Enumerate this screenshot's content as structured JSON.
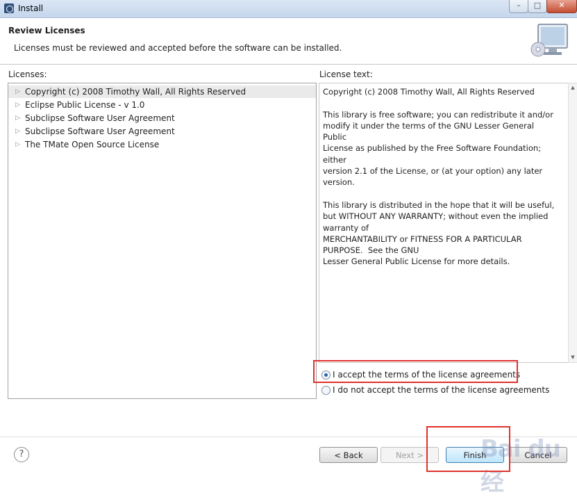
{
  "window": {
    "title": "Install",
    "minimize_glyph": "–",
    "maximize_glyph": "□",
    "close_glyph": "✕"
  },
  "header": {
    "title": "Review Licenses",
    "description": "Licenses must be reviewed and accepted before the software can be installed."
  },
  "licenses": {
    "label": "Licenses:",
    "items": [
      "Copyright (c) 2008 Timothy Wall, All Rights Reserved",
      "Eclipse Public License - v 1.0",
      "Subclipse Software User Agreement",
      "Subclipse Software User Agreement",
      "The TMate Open Source License"
    ],
    "selected_index": 0
  },
  "license_text": {
    "label": "License text:",
    "content": "Copyright (c) 2008 Timothy Wall, All Rights Reserved\n\nThis library is free software; you can redistribute it and/or\nmodify it under the terms of the GNU Lesser General Public\nLicense as published by the Free Software Foundation; either\nversion 2.1 of the License, or (at your option) any later\nversion.\n\nThis library is distributed in the hope that it will be useful,\nbut WITHOUT ANY WARRANTY; without even the implied\nwarranty of\nMERCHANTABILITY or FITNESS FOR A PARTICULAR\nPURPOSE.  See the GNU\nLesser General Public License for more details."
  },
  "radios": {
    "accept": "I accept the terms of the license agreements",
    "decline": "I do not accept the terms of the license agreements",
    "selected": "accept"
  },
  "footer": {
    "help_glyph": "?",
    "back": "< Back",
    "next": "Next >",
    "finish": "Finish",
    "cancel": "Cancel"
  },
  "watermark": "Bai du 经",
  "colors": {
    "highlight": "#e0302a",
    "radio_selected": "#2a5fb0"
  },
  "icons": {
    "monitor": "monitor-with-cd-icon",
    "tree_arrow": "triangle-right-icon"
  }
}
